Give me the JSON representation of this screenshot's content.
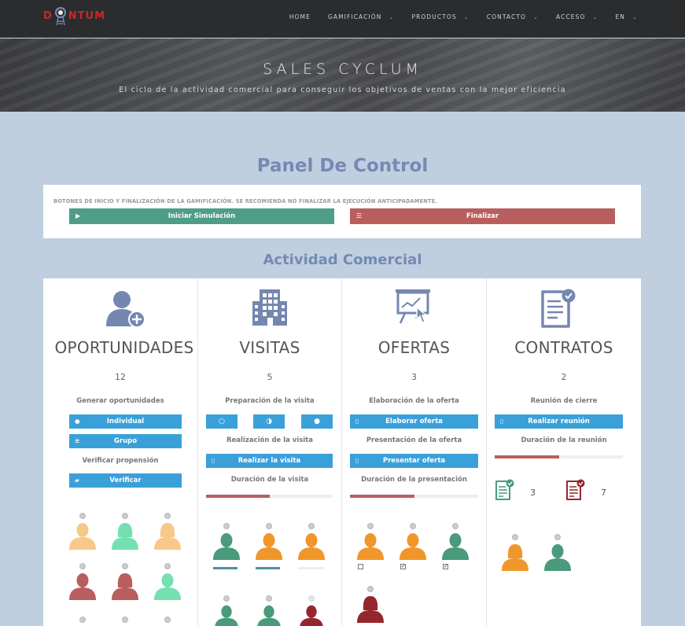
{
  "nav": {
    "logo_left": "D",
    "logo_right": "NTUM",
    "items": [
      {
        "label": "HOME",
        "caret": ""
      },
      {
        "label": "GAMIFICACIÓN",
        "caret": "⌄"
      },
      {
        "label": "PRODUCTOS",
        "caret": "⌄"
      },
      {
        "label": "CONTACTO",
        "caret": "⌄"
      },
      {
        "label": "ACCESO",
        "caret": "⌄"
      },
      {
        "label": "EN",
        "caret": "⌄"
      }
    ]
  },
  "hero": {
    "title": "SALES CYCLUM",
    "subtitle": "El ciclo de la actividad comercial para conseguir los objetivos de ventas con la mejor eficiencia"
  },
  "panel": {
    "title": "Panel De Control",
    "note": "BOTONES DE INICIO Y FINALIZACIÓN DE LA GAMIFICACIÓN. SE RECOMIENDA NO FINALIZAR LA EJECUCIÓN ANTICIPADAMENTE.",
    "start_label": "Iniciar Simulación",
    "end_label": "Finalizar",
    "start_color": "#4f9d86",
    "end_color": "#b85e5e"
  },
  "activity": {
    "title": "Actividad Comercial",
    "oportunidades": {
      "title": "OPORTUNIDADES",
      "count": "12",
      "generate_label": "Generar oportunidades",
      "individual_label": "Individual",
      "grupo_label": "Grupo",
      "verify_label": "Verificar propensión",
      "verificar_label": "Verificar"
    },
    "visitas": {
      "title": "VISITAS",
      "count": "5",
      "prep_label": "Preparación de la visita",
      "real_label": "Realización de la visita",
      "real_button": "Realizar la visita",
      "duration_label": "Duración de la visita",
      "duration_progress": 0.5
    },
    "ofertas": {
      "title": "OFERTAS",
      "count": "3",
      "elab_label": "Elaboración de la oferta",
      "elab_button": "Elaborar oferta",
      "pres_label": "Presentación de la oferta",
      "pres_button": "Presentar oferta",
      "duration_label": "Duración de la presentación",
      "duration_progress": 0.5
    },
    "contratos": {
      "title": "CONTRATOS",
      "count": "2",
      "meeting_label": "Reunión de cierre",
      "meeting_button": "Realizar reunión",
      "duration_label": "Duración de la reunión",
      "duration_progress": 0.5,
      "won": "3",
      "lost": "7"
    }
  },
  "colors": {
    "accent_blue": "#3aa0da",
    "heading": "#7589b4",
    "icon": "#7487b0",
    "teal": "#4a9a7c",
    "orange": "#f0962a",
    "pale_orange": "#f6c98a",
    "mint": "#74e0b0",
    "red": "#b85e5e",
    "crimson": "#96262e"
  }
}
